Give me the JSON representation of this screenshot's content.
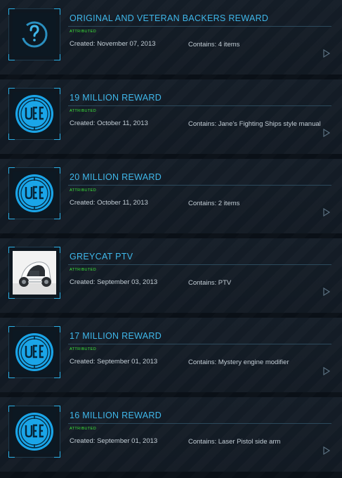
{
  "items": [
    {
      "title": "ORIGINAL AND VETERAN BACKERS REWARD",
      "status": "ATTRIBUTED",
      "created": "Created: November 07, 2013",
      "contains": "Contains: 4 items",
      "icon": "question-icon"
    },
    {
      "title": "19 MILLION REWARD",
      "status": "ATTRIBUTED",
      "created": "Created: October 11, 2013",
      "contains": "Contains: Jane's Fighting Ships style manual",
      "icon": "uee-emblem-icon"
    },
    {
      "title": "20 MILLION REWARD",
      "status": "ATTRIBUTED",
      "created": "Created: October 11, 2013",
      "contains": "Contains: 2 items",
      "icon": "uee-emblem-icon"
    },
    {
      "title": "GREYCAT PTV",
      "status": "ATTRIBUTED",
      "created": "Created: September 03, 2013",
      "contains": "Contains: PTV",
      "icon": "greycat-ptv-image"
    },
    {
      "title": "17 MILLION REWARD",
      "status": "ATTRIBUTED",
      "created": "Created: September 01, 2013",
      "contains": "Contains: Mystery engine modifier",
      "icon": "uee-emblem-icon"
    },
    {
      "title": "16 MILLION REWARD",
      "status": "ATTRIBUTED",
      "created": "Created: September 01, 2013",
      "contains": "Contains: Laser Pistol side arm",
      "icon": "uee-emblem-icon"
    }
  ],
  "colors": {
    "accent": "#3fb7ea",
    "status": "#3ee83a",
    "text": "#c3ced6",
    "background": "#0a1017"
  }
}
